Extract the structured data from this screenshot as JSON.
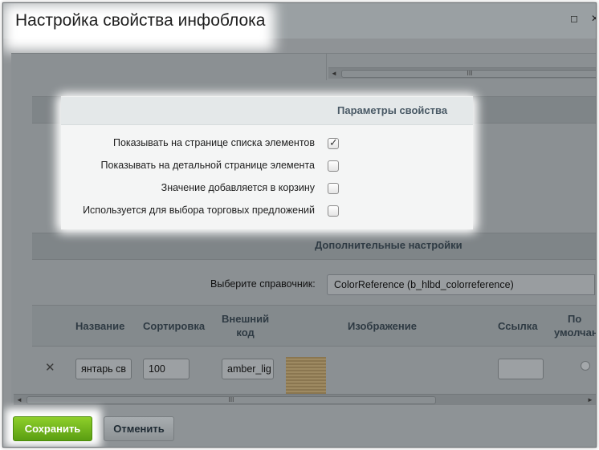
{
  "window": {
    "title": "Настройка свойства инфоблока",
    "maximize_icon": "maximize-icon",
    "close_icon": "close-icon"
  },
  "scroll": {
    "left_arrow": "◄",
    "right_arrow": "►",
    "thumb_grip": "III"
  },
  "params": {
    "title": "Параметры свойства",
    "rows": [
      {
        "label": "Показывать на странице списка элементов",
        "checked": true
      },
      {
        "label": "Показывать на детальной странице элемента",
        "checked": false
      },
      {
        "label": "Значение добавляется в корзину",
        "checked": false
      },
      {
        "label": "Используется для выбора торговых предложений",
        "checked": false
      }
    ]
  },
  "additional": {
    "title": "Дополнительные настройки",
    "directory_label": "Выберите справочник:",
    "directory_value": "ColorReference (b_hlbd_colorreference)"
  },
  "table": {
    "headers": {
      "name": "Название",
      "sort": "Сортировка",
      "external_code_1": "Внешний",
      "external_code_2": "код",
      "image": "Изображение",
      "link": "Ссылка",
      "default_1": "По",
      "default_2": "умолчан"
    },
    "row": {
      "delete_icon": "✕",
      "name": "янтарь св",
      "sort": "100",
      "external_code": "amber_lig",
      "link": ""
    }
  },
  "footer": {
    "save_label": "Сохранить",
    "cancel_label": "Отменить"
  },
  "colors": {
    "save_button": "#6fb31a",
    "overlay": "#8b9093",
    "highlight": "#ffffff"
  }
}
